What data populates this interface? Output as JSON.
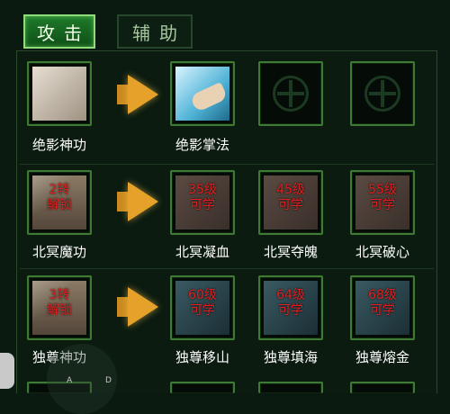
{
  "tabs": {
    "attack": "攻击",
    "assist": "辅助"
  },
  "rows": [
    {
      "source": {
        "label": "绝影神功",
        "overlay": []
      },
      "targets": [
        {
          "label": "绝影掌法",
          "overlay": [],
          "locked": false
        },
        {
          "label": "",
          "overlay": [],
          "locked": true
        },
        {
          "label": "",
          "overlay": [],
          "locked": true
        }
      ]
    },
    {
      "source": {
        "label": "北冥魔功",
        "overlay": [
          "2转",
          "解锁"
        ]
      },
      "targets": [
        {
          "label": "北冥凝血",
          "overlay": [
            "35级",
            "可学"
          ],
          "locked": false
        },
        {
          "label": "北冥夺魄",
          "overlay": [
            "45级",
            "可学"
          ],
          "locked": false
        },
        {
          "label": "北冥破心",
          "overlay": [
            "55级",
            "可学"
          ],
          "locked": false
        }
      ]
    },
    {
      "source": {
        "label": "独尊神功",
        "overlay": [
          "3转",
          "解锁"
        ]
      },
      "targets": [
        {
          "label": "独尊移山",
          "overlay": [
            "60级",
            "可学"
          ],
          "locked": false
        },
        {
          "label": "独尊填海",
          "overlay": [
            "64级",
            "可学"
          ],
          "locked": false
        },
        {
          "label": "独尊熔金",
          "overlay": [
            "68级",
            "可学"
          ],
          "locked": false
        }
      ]
    }
  ],
  "controls": {
    "a": "A",
    "d": "D"
  },
  "colors": {
    "frame": "#3f7a34",
    "arrow": "#e6a12a",
    "lock_text": "#e02020",
    "tab_active": "#1f7a2a"
  }
}
